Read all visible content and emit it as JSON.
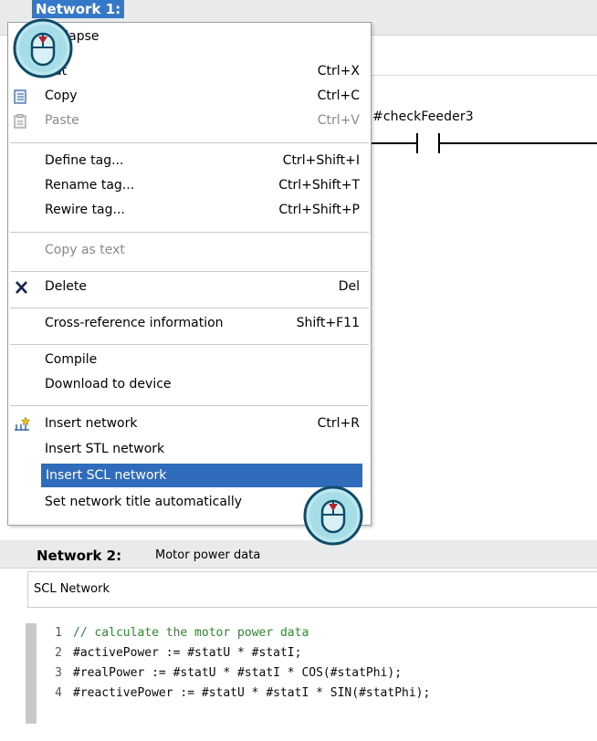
{
  "network1": {
    "title": "Network 1:",
    "contact_tag": "#checkFeeder3"
  },
  "context_menu": {
    "items": [
      {
        "label": "Collapse",
        "shortcut": ""
      },
      {
        "label": "Cut",
        "shortcut": "Ctrl+X"
      },
      {
        "label": "Copy",
        "shortcut": "Ctrl+C"
      },
      {
        "label": "Paste",
        "shortcut": "Ctrl+V"
      },
      {
        "label": "Define tag...",
        "shortcut": "Ctrl+Shift+I"
      },
      {
        "label": "Rename tag...",
        "shortcut": "Ctrl+Shift+T"
      },
      {
        "label": "Rewire tag...",
        "shortcut": "Ctrl+Shift+P"
      },
      {
        "label": "Copy as text",
        "shortcut": ""
      },
      {
        "label": "Delete",
        "shortcut": "Del"
      },
      {
        "label": "Cross-reference information",
        "shortcut": "Shift+F11"
      },
      {
        "label": "Compile",
        "shortcut": ""
      },
      {
        "label": "Download to device",
        "shortcut": ""
      },
      {
        "label": "Insert network",
        "shortcut": "Ctrl+R"
      },
      {
        "label": "Insert STL network",
        "shortcut": ""
      },
      {
        "label": "Insert SCL network",
        "shortcut": ""
      },
      {
        "label": "Set network title automatically",
        "shortcut": ""
      }
    ],
    "highlight_color": "#2f6dbc"
  },
  "network2": {
    "label": "Network 2:",
    "title": "Motor power data",
    "type_label": "SCL Network",
    "code": [
      {
        "num": "1",
        "text": "// calculate the motor power data"
      },
      {
        "num": "2",
        "text": "#activePower := #statU * #statI;"
      },
      {
        "num": "3",
        "text": "#realPower := #statU * #statI * COS(#statPhi);"
      },
      {
        "num": "4",
        "text": "#reactivePower := #statU * #statI * SIN(#statPhi);"
      }
    ]
  },
  "icons": {
    "mouse": "mouse-click-icon",
    "copy": "copy-icon",
    "paste": "paste-icon",
    "delete": "delete-x-icon",
    "insert_network": "insert-network-icon"
  }
}
